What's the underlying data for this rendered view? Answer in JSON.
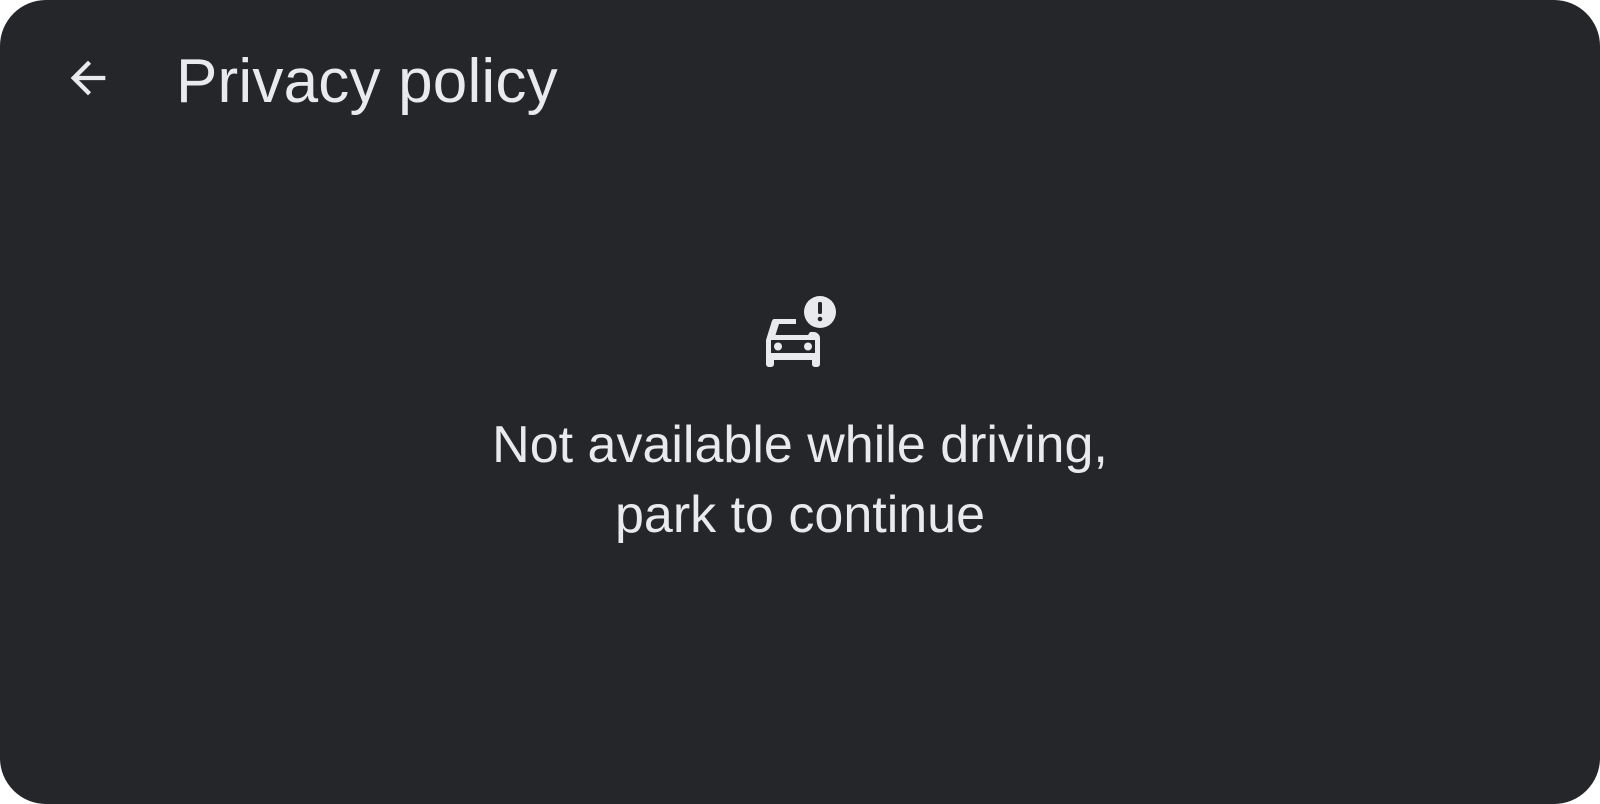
{
  "header": {
    "title": "Privacy policy",
    "back_icon": "arrow-back-icon"
  },
  "message": {
    "icon": "car-alert-icon",
    "line1": "Not available while driving,",
    "line2": "park to continue"
  },
  "colors": {
    "background": "#25262a",
    "text": "#e8eaed"
  }
}
